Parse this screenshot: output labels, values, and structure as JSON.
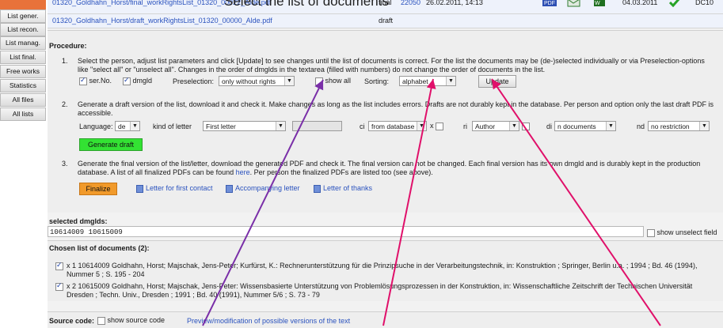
{
  "caption": "Select the list of documents",
  "sidebar": {
    "items": [
      {
        "label": "List gener."
      },
      {
        "label": "List recon."
      },
      {
        "label": "List manag."
      },
      {
        "label": "List final."
      },
      {
        "label": "Free works"
      },
      {
        "label": "Statistics"
      },
      {
        "label": "All files"
      },
      {
        "label": "All lists"
      }
    ]
  },
  "files": [
    {
      "name": "01320_Goldhahn_Horst/final_workRightsList_01320_00022_Alde.pdf",
      "status": "final",
      "size": "22050",
      "date": "26.02.2011, 14:13",
      "date2": "04.03.2011",
      "code": "DC10"
    },
    {
      "name": "01320_Goldhahn_Horst/draft_workRightsList_01320_00000_Alde.pdf",
      "status": "draft"
    }
  ],
  "procedure": {
    "title": "Procedure:",
    "step1": {
      "num": "1.",
      "text": "Select the person, adjust list parameters and click [Update] to see changes until the list of documents is correct. For the list the documents may be (de-)selected individually or via Preselection-options like \"select all\" or \"unselect all\". Changes in the order of dmglds in the textarea (filled with numbers) do not change the order of documents in the list.",
      "serno_label": "ser.No.",
      "dmgld_label": "dmgld",
      "preselection_label": "Preselection:",
      "preselection_value": "only without rights",
      "showall_label": "show all",
      "sorting_label": "Sorting:",
      "sorting_value": "alphabet",
      "update_label": "Update"
    },
    "step2": {
      "num": "2.",
      "text": "Generate a draft version of the list, download it and check it. Make changes as long as the list includes errors. Drafts are not durably kept in the database. Per person and option only the last draft PDF is accessible.",
      "language_label": "Language:",
      "language_value": "de",
      "kind_label": "kind of letter",
      "kind_value": "First letter",
      "ci_label": "ci",
      "ci_value": "from database",
      "x_label": "x",
      "ri_label": "ri",
      "ri_value": "Author",
      "di_label": "di",
      "di_value": "n documents",
      "nd_label": "nd",
      "nd_value": "no restriction",
      "generate_label": "Generate draft"
    },
    "step3": {
      "num": "3.",
      "text_a": "Generate the final version of the list/letter, download the generated PDF and check it. The final version can not be changed. Each final version has its own dmgld and is durably kept in the production database. A list of all finalized PDFs can be found ",
      "here": "here",
      "text_b": ". Per person the finalized PDFs are listed too (see above).",
      "finalize_label": "Finalize",
      "link1": "Letter for first contact",
      "link2": "Accompanying letter",
      "link3": "Letter of thanks"
    }
  },
  "selected": {
    "title": "selected dmglds:",
    "value": "10614009 10615009",
    "unselect_label": "show unselect field"
  },
  "chosen": {
    "title": "Chosen list of documents (2):",
    "items": [
      {
        "text": "x 1 10614009 Goldhahn, Horst; Majschak, Jens-Peter; Kurfürst, K.: Rechnerunterstützung für die Prinzipsuche in der Verarbeitungstechnik, in: Konstruktion ; Springer, Berlin u.a. ; 1994 ; Bd. 46 (1994), Nummer 5 ; S. 195 - 204"
      },
      {
        "text": "x 2 10615009 Goldhahn, Horst; Majschak, Jens-Peter: Wissensbasierte Unterstützung von Problemlösungsprozessen in der Konstruktion, in: Wissenschaftliche Zeitschrift der Technischen Universität Dresden ; Techn. Univ., Dresden ; 1991 ; Bd. 40 (1991), Nummer 5/6 ; S. 73 - 79"
      }
    ]
  },
  "source": {
    "label": "Source code:",
    "checkbox_label": "show source code",
    "link": "Preview/modification of possible versions of the text"
  }
}
